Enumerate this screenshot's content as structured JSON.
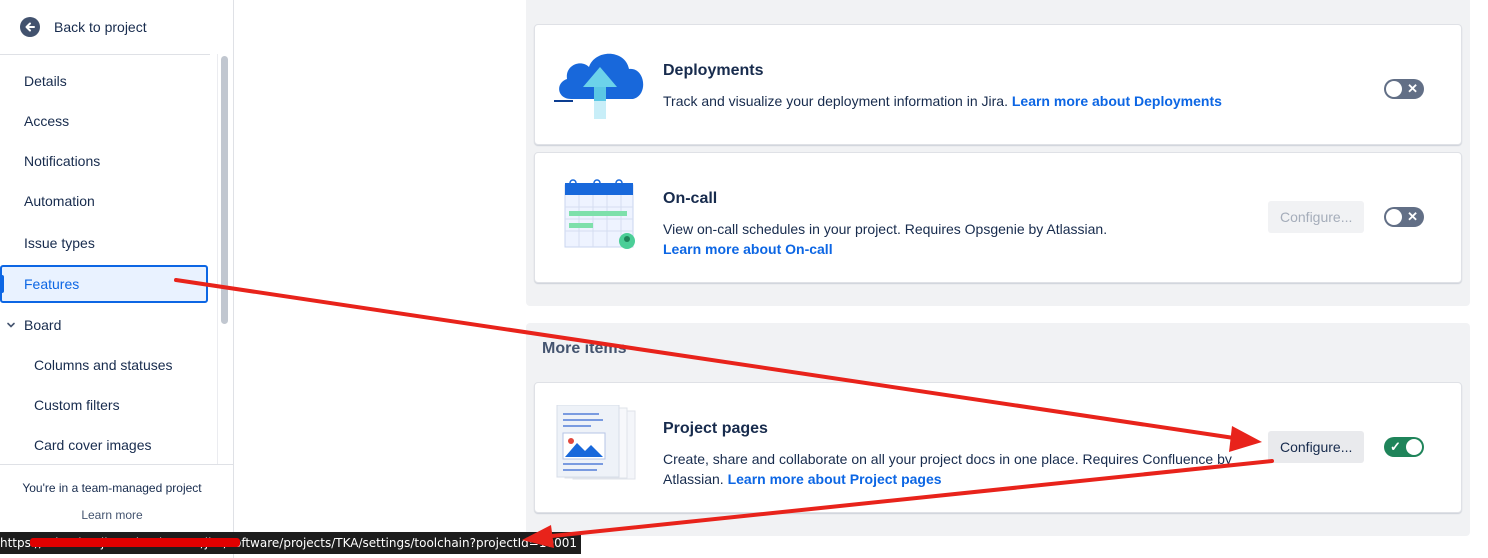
{
  "sidebar": {
    "back_label": "Back to project",
    "items": [
      {
        "label": "Details"
      },
      {
        "label": "Access"
      },
      {
        "label": "Notifications"
      },
      {
        "label": "Automation"
      },
      {
        "label": "Issue types"
      },
      {
        "label": "Features"
      },
      {
        "label": "Board"
      },
      {
        "label": "Columns and statuses"
      },
      {
        "label": "Custom filters"
      },
      {
        "label": "Card cover images"
      }
    ],
    "footer_note": "You're in a team-managed project",
    "footer_link": "Learn more"
  },
  "features": [
    {
      "title": "Deployments",
      "description": "Track and visualize your deployment information in Jira.",
      "link": "Learn more about Deployments",
      "toggle_symbol": "✕"
    },
    {
      "title": "On-call",
      "description": "View on-call schedules in your project. Requires Opsgenie by Atlassian.",
      "link": "Learn more about On-call",
      "button": "Configure...",
      "toggle_symbol": "✕"
    }
  ],
  "more_items": {
    "heading": "More items",
    "card": {
      "title": "Project pages",
      "description": "Create, share and collaborate on all your project docs in one place. Requires Confluence by Atlassian.",
      "link": "Learn more about Project pages",
      "button": "Configure...",
      "toggle_symbol": "✓"
    }
  },
  "statusbar": {
    "url": "https://atlassian-jira.atlassian.net/jira/software/projects/TKA/settings/toolchain?projectId=10001"
  },
  "colors": {
    "accent": "#0c66e4",
    "toggle_on": "#1f845a",
    "toggle_off": "#626f86",
    "annotation": "#e8231b"
  },
  "icons": [
    "arrow-left-icon",
    "chevron-down-icon",
    "cloud-upload-icon",
    "calendar-icon",
    "document-pages-icon"
  ]
}
